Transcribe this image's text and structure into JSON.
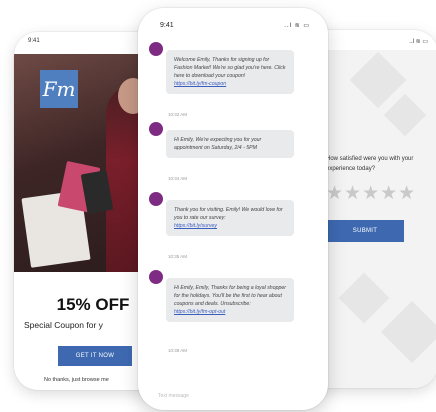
{
  "left_phone": {
    "status_time": "9:41",
    "logo_text": "Fm",
    "headline": "15% OFF",
    "subheadline": "Special Coupon for y",
    "cta_button": "GET IT NOW",
    "dismiss_link": "No thanks, just browse me",
    "brand_color": "#3e69b1"
  },
  "center_phone": {
    "status_time": "9:41",
    "status_icons": "..l ≋ ▭",
    "avatar_color": "#7e2c83",
    "messages": [
      {
        "text": "Welcome Emily, Thanks for signing up for Fashion Market! We're so glad you're here. Click here to download your coupon!",
        "link": "https://bit.ly/fm-coupon",
        "timestamp": "10:32 AM"
      },
      {
        "text": "Hi Emily, We're expecting you for your appointment on Saturday, 2/4 - 5PM",
        "link": "",
        "timestamp": "10:34 AM"
      },
      {
        "text": "Thank you for visiting. Emily! We would love for you to rate our survey:",
        "link": "https://bit.ly/survey",
        "timestamp": "10:35 AM"
      },
      {
        "text": "Hi Emily, Emily, Thanks for being a loyal shopper for the holidays. You'll be the first to hear about coupons and deals. Unsubscribe:",
        "link": "https://bit.ly/fm-opt-out",
        "timestamp": "10:38 AM"
      }
    ],
    "composer_placeholder": "Text message"
  },
  "right_phone": {
    "status_icons": "..l ≋ ▭",
    "question": "How satisfied were you with your experience today?",
    "stars": "★★★★★",
    "submit_button": "SUBMIT"
  }
}
